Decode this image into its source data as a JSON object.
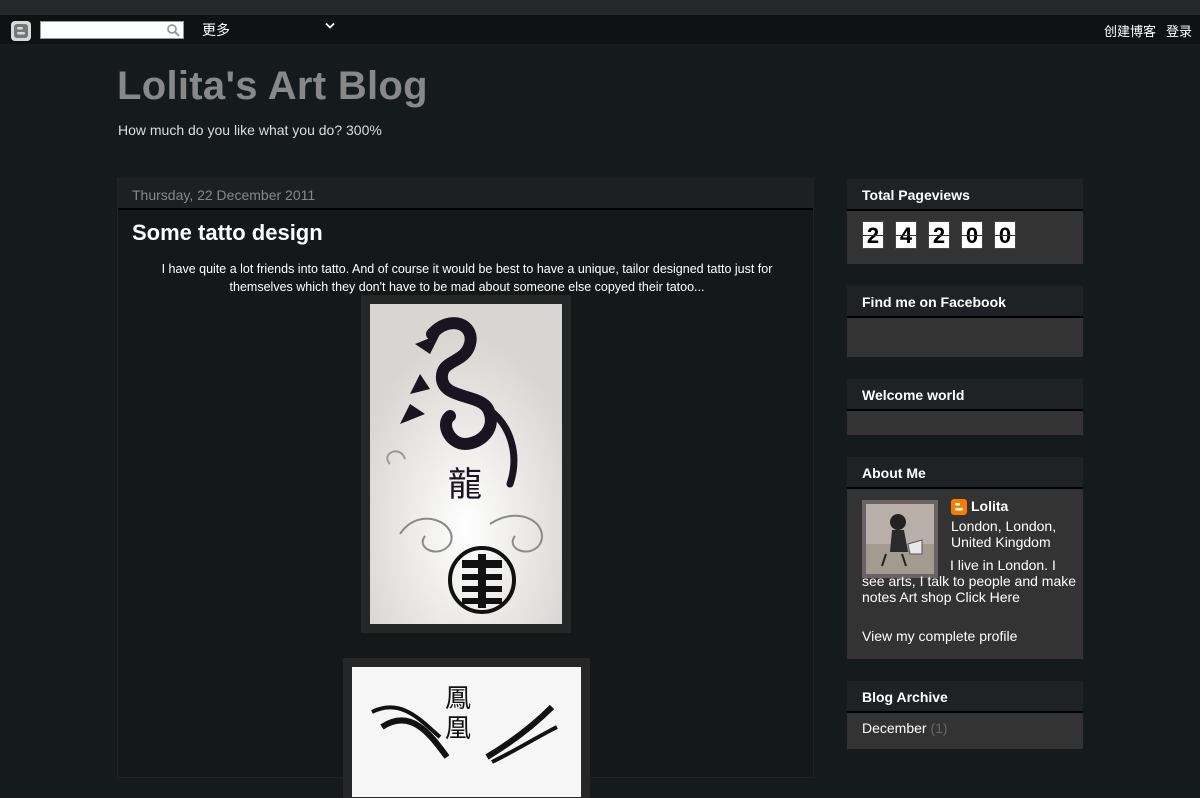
{
  "navbar": {
    "more_label": "更多",
    "create_blog_label": "创建博客",
    "login_label": "登录"
  },
  "header": {
    "title": "Lolita's Art Blog",
    "description": "How much do you like what you do? 300%"
  },
  "post": {
    "date": "Thursday, 22 December 2011",
    "title": "Some tatto design",
    "body": "I have quite a lot friends into tatto. And of course it would be best to have a unique, tailor designed tatto just for themselves which they don't have to be mad about someone else copyed their tatoo..."
  },
  "sidebar": {
    "pageviews": {
      "title": "Total Pageviews",
      "digits": [
        "2",
        "4",
        "2",
        "0",
        "0"
      ]
    },
    "facebook": {
      "title": "Find me on Facebook"
    },
    "welcome": {
      "title": "Welcome world"
    },
    "about": {
      "title": "About Me",
      "name": "Lolita",
      "location": "London, London, United Kingdom",
      "text": "I live in London. I see arts, I talk to people and make notes Art shop Click Here",
      "profile_link": "View my complete profile"
    },
    "archive": {
      "title": "Blog Archive",
      "month": "December",
      "count": "(1)"
    }
  },
  "colors": {
    "background": "#151a1c",
    "title": "#888888",
    "widget": "#333333",
    "blogger_orange": "#f57d00"
  }
}
